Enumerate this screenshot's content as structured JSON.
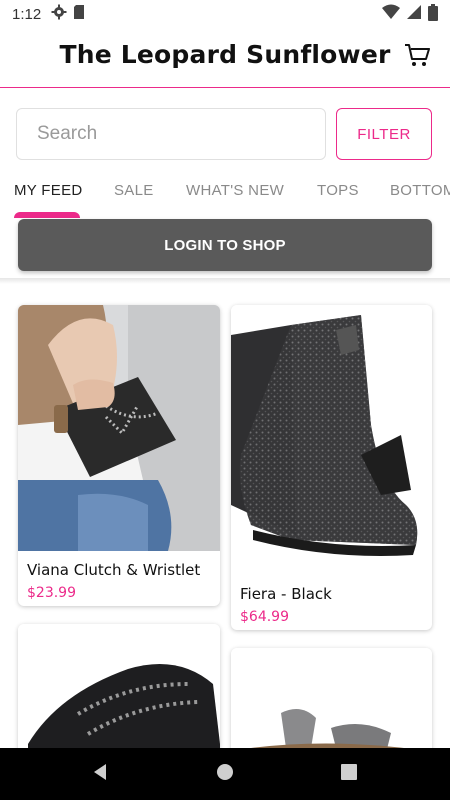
{
  "status_bar": {
    "time": "1:12"
  },
  "header": {
    "title": "The Leopard Sunflower"
  },
  "search": {
    "placeholder": "Search",
    "value": ""
  },
  "filter": {
    "label": "FILTER"
  },
  "tabs": [
    {
      "label": "MY FEED",
      "active": true
    },
    {
      "label": "SALE",
      "active": false
    },
    {
      "label": "WHAT'S NEW",
      "active": false
    },
    {
      "label": "TOPS",
      "active": false
    },
    {
      "label": "BOTTOM",
      "active": false
    }
  ],
  "login": {
    "label": "LOGIN TO SHOP"
  },
  "products": [
    {
      "name": "Viana Clutch & Wristlet",
      "price": "$23.99"
    },
    {
      "name": "Fiera - Black",
      "price": "$64.99"
    },
    {
      "name": "",
      "price": ""
    },
    {
      "name": "",
      "price": ""
    }
  ],
  "colors": {
    "accent": "#ec2a8a",
    "login_bg": "#5a5a5a",
    "nav_bg": "#000000"
  },
  "icons": [
    "settings-icon",
    "sim-card-icon",
    "wifi-icon",
    "signal-icon",
    "battery-icon",
    "cart-icon",
    "back-icon",
    "home-icon",
    "recents-icon"
  ]
}
